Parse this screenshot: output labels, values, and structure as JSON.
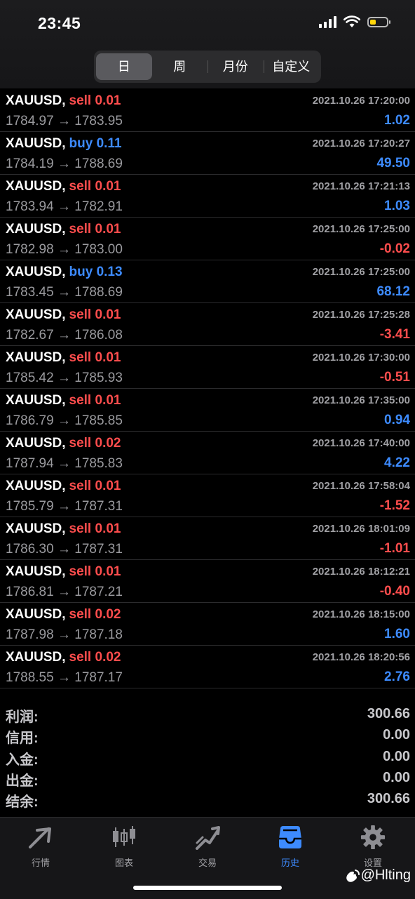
{
  "status_bar": {
    "time": "23:45"
  },
  "period_tabs": [
    {
      "label": "日",
      "active": true
    },
    {
      "label": "周",
      "active": false
    },
    {
      "label": "月份",
      "active": false
    },
    {
      "label": "自定义",
      "active": false
    }
  ],
  "trades": [
    {
      "symbol": "XAUUSD,",
      "side": "sell",
      "volume": "0.01",
      "time": "2021.10.26 17:20:00",
      "open": "1784.97",
      "close": "1783.95",
      "profit": "1.02"
    },
    {
      "symbol": "XAUUSD,",
      "side": "buy",
      "volume": "0.11",
      "time": "2021.10.26 17:20:27",
      "open": "1784.19",
      "close": "1788.69",
      "profit": "49.50"
    },
    {
      "symbol": "XAUUSD,",
      "side": "sell",
      "volume": "0.01",
      "time": "2021.10.26 17:21:13",
      "open": "1783.94",
      "close": "1782.91",
      "profit": "1.03"
    },
    {
      "symbol": "XAUUSD,",
      "side": "sell",
      "volume": "0.01",
      "time": "2021.10.26 17:25:00",
      "open": "1782.98",
      "close": "1783.00",
      "profit": "-0.02"
    },
    {
      "symbol": "XAUUSD,",
      "side": "buy",
      "volume": "0.13",
      "time": "2021.10.26 17:25:00",
      "open": "1783.45",
      "close": "1788.69",
      "profit": "68.12"
    },
    {
      "symbol": "XAUUSD,",
      "side": "sell",
      "volume": "0.01",
      "time": "2021.10.26 17:25:28",
      "open": "1782.67",
      "close": "1786.08",
      "profit": "-3.41"
    },
    {
      "symbol": "XAUUSD,",
      "side": "sell",
      "volume": "0.01",
      "time": "2021.10.26 17:30:00",
      "open": "1785.42",
      "close": "1785.93",
      "profit": "-0.51"
    },
    {
      "symbol": "XAUUSD,",
      "side": "sell",
      "volume": "0.01",
      "time": "2021.10.26 17:35:00",
      "open": "1786.79",
      "close": "1785.85",
      "profit": "0.94"
    },
    {
      "symbol": "XAUUSD,",
      "side": "sell",
      "volume": "0.02",
      "time": "2021.10.26 17:40:00",
      "open": "1787.94",
      "close": "1785.83",
      "profit": "4.22"
    },
    {
      "symbol": "XAUUSD,",
      "side": "sell",
      "volume": "0.01",
      "time": "2021.10.26 17:58:04",
      "open": "1785.79",
      "close": "1787.31",
      "profit": "-1.52"
    },
    {
      "symbol": "XAUUSD,",
      "side": "sell",
      "volume": "0.01",
      "time": "2021.10.26 18:01:09",
      "open": "1786.30",
      "close": "1787.31",
      "profit": "-1.01"
    },
    {
      "symbol": "XAUUSD,",
      "side": "sell",
      "volume": "0.01",
      "time": "2021.10.26 18:12:21",
      "open": "1786.81",
      "close": "1787.21",
      "profit": "-0.40"
    },
    {
      "symbol": "XAUUSD,",
      "side": "sell",
      "volume": "0.02",
      "time": "2021.10.26 18:15:00",
      "open": "1787.98",
      "close": "1787.18",
      "profit": "1.60"
    },
    {
      "symbol": "XAUUSD,",
      "side": "sell",
      "volume": "0.02",
      "time": "2021.10.26 18:20:56",
      "open": "1788.55",
      "close": "1787.17",
      "profit": "2.76"
    }
  ],
  "summary": [
    {
      "label": "利润:",
      "value": "300.66"
    },
    {
      "label": "信用:",
      "value": "0.00"
    },
    {
      "label": "入金:",
      "value": "0.00"
    },
    {
      "label": "出金:",
      "value": "0.00"
    },
    {
      "label": "结余:",
      "value": "300.66"
    }
  ],
  "tab_bar": [
    {
      "label": "行情",
      "icon": "quotes-icon",
      "active": false
    },
    {
      "label": "图表",
      "icon": "chart-icon",
      "active": false
    },
    {
      "label": "交易",
      "icon": "trade-icon",
      "active": false
    },
    {
      "label": "历史",
      "icon": "history-icon",
      "active": true
    },
    {
      "label": "设置",
      "icon": "settings-icon",
      "active": false
    }
  ],
  "watermark": "@Hlting",
  "colors": {
    "sell": "#ff4d4d",
    "buy": "#3d8bff",
    "profit_positive": "#3d8bff",
    "profit_negative": "#ff4d4d",
    "active_tab": "#3d8bff"
  }
}
